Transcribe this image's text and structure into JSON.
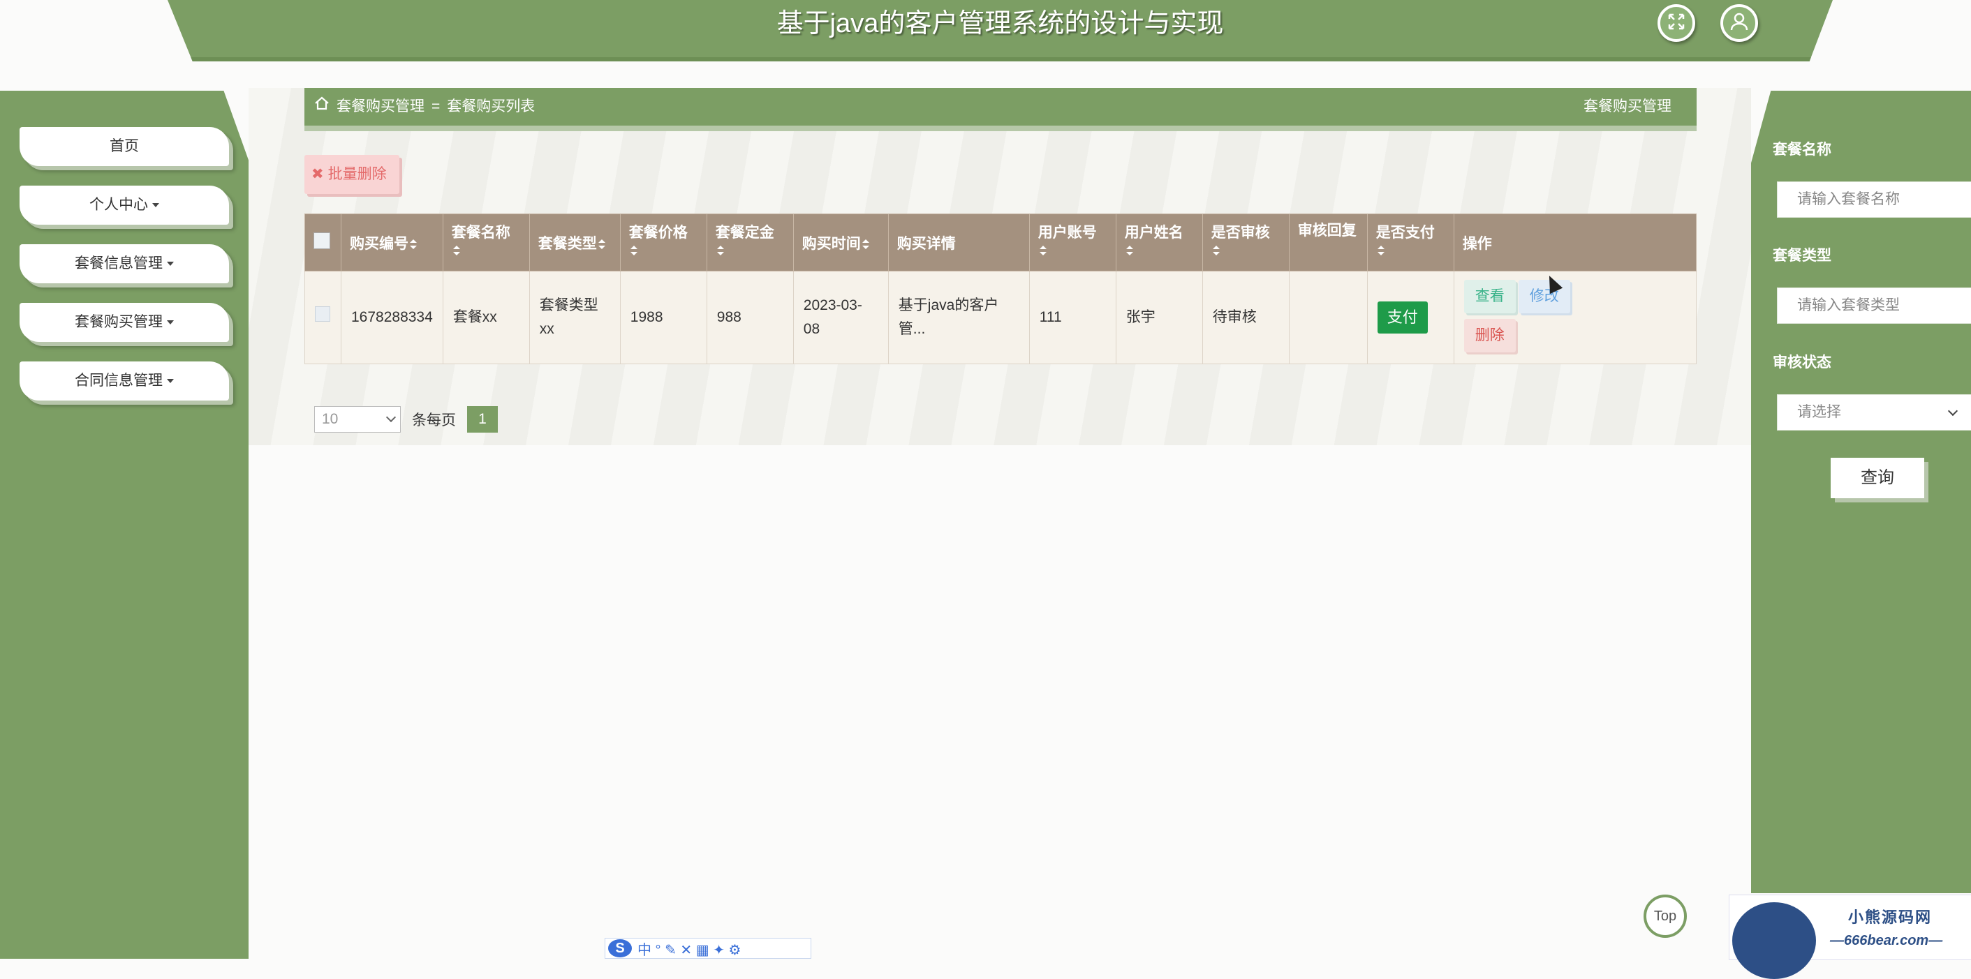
{
  "header": {
    "title": "基于java的客户管理系统的设计与实现",
    "fullscreen_icon": "fullscreen-icon",
    "user_icon": "user-icon"
  },
  "sidebar": {
    "items": [
      {
        "label": "首页",
        "dropdown": false
      },
      {
        "label": "个人中心",
        "dropdown": true
      },
      {
        "label": "套餐信息管理",
        "dropdown": true
      },
      {
        "label": "套餐购买管理",
        "dropdown": true
      },
      {
        "label": "合同信息管理",
        "dropdown": true
      }
    ]
  },
  "breadcrumb": {
    "home_icon": "home-icon",
    "section": "套餐购买管理",
    "separator": "=",
    "page": "套餐购买列表",
    "right_title": "套餐购买管理"
  },
  "toolbar": {
    "batch_delete_label": "批量删除"
  },
  "table": {
    "columns": [
      "购买编号",
      "套餐名称",
      "套餐类型",
      "套餐价格",
      "套餐定金",
      "购买时间",
      "购买详情",
      "用户账号",
      "用户姓名",
      "是否审核",
      "审核回复",
      "是否支付",
      "操作"
    ],
    "rows": [
      {
        "purchase_no": "1678288334",
        "package_name": "套餐xx",
        "package_type": "套餐类型xx",
        "price": "1988",
        "deposit": "988",
        "purchase_time": "2023-03-08",
        "details": "基于java的客户管...",
        "account": "111",
        "user_name": "张宇",
        "review_status": "待审核",
        "review_reply": "",
        "pay_label": "支付",
        "view_label": "查看",
        "edit_label": "修改",
        "delete_label": "删除"
      }
    ]
  },
  "pagination": {
    "page_size": "10",
    "per_page_label": "条每页",
    "current_page": "1"
  },
  "filters": {
    "package_name_label": "套餐名称",
    "package_name_placeholder": "请输入套餐名称",
    "package_type_label": "套餐类型",
    "package_type_placeholder": "请输入套餐类型",
    "review_status_label": "审核状态",
    "review_status_value": "请选择",
    "query_label": "查询"
  },
  "misc": {
    "top_label": "Top",
    "watermark_title": "小熊源码网",
    "watermark_url": "—666bear.com—",
    "ime_chars": "中 ° ✎ ✕ ▦ ✦ ⚙"
  },
  "colors": {
    "theme_green": "#7c9e64",
    "table_header": "#a4917f",
    "pay_green": "#1e9b49",
    "delete_red": "#d9534f"
  }
}
